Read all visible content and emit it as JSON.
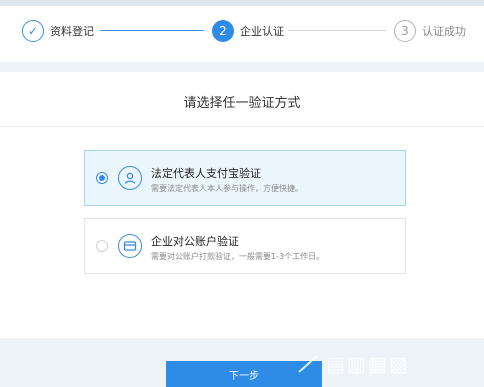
{
  "steps": [
    {
      "number": "✓",
      "label": "资料登记",
      "status": "done"
    },
    {
      "number": "2",
      "label": "企业认证",
      "status": "active"
    },
    {
      "number": "3",
      "label": "认证成功",
      "status": "pending"
    }
  ],
  "section_title": "请选择任一验证方式",
  "options": [
    {
      "title": "法定代表人支付宝验证",
      "desc": "需要法定代表人本人参与操作，方便快捷。",
      "icon": "person-icon",
      "selected": true
    },
    {
      "title": "企业对公账户验证",
      "desc": "需要对公账户打款验证，一般需要1-3个工作日。",
      "icon": "card-icon",
      "selected": false
    }
  ],
  "next_button": "下一步",
  "colors": {
    "accent": "#2e8ce6",
    "selected_bg": "#eaf5fc",
    "page_bg": "#eef3f8"
  }
}
